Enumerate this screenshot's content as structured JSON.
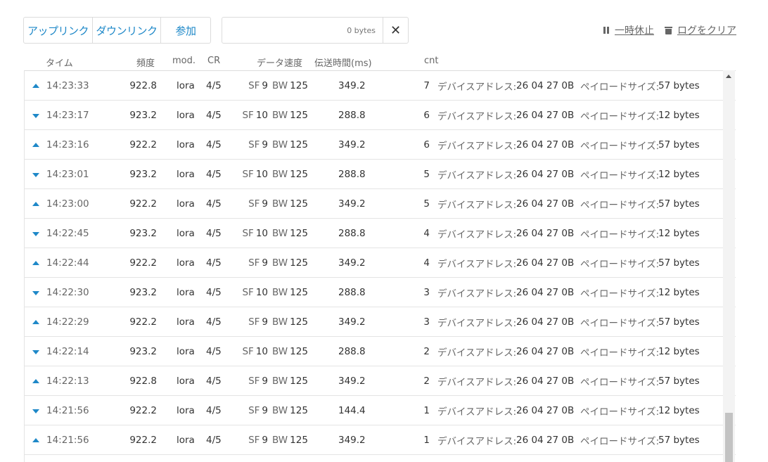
{
  "toolbar": {
    "filters": [
      "アップリンク",
      "ダウンリンク",
      "参加"
    ],
    "search_placeholder": "0 bytes",
    "clear_symbol": "✕",
    "pause_label": "一時休止",
    "clear_log_label": "ログをクリア"
  },
  "columns": {
    "time": "タイム",
    "freq": "頻度",
    "mod": "mod.",
    "cr": "CR",
    "datarate": "データ速度",
    "airtime": "伝送時間(ms)",
    "cnt": "cnt"
  },
  "labels": {
    "sf": "SF",
    "bw": "BW",
    "device_address": "デバイスアドレス:",
    "payload_size": "ペイロードサイズ:"
  },
  "rows": [
    {
      "dir": "up",
      "time": "14:23:33",
      "freq": "922.8",
      "mod": "lora",
      "cr": "4/5",
      "sf": "9",
      "bw": "125",
      "airtime": "349.2",
      "cnt": "7",
      "devaddr": "26 04 27 0B",
      "payload": "57 bytes"
    },
    {
      "dir": "down",
      "time": "14:23:17",
      "freq": "923.2",
      "mod": "lora",
      "cr": "4/5",
      "sf": "10",
      "bw": "125",
      "airtime": "288.8",
      "cnt": "6",
      "devaddr": "26 04 27 0B",
      "payload": "12 bytes"
    },
    {
      "dir": "up",
      "time": "14:23:16",
      "freq": "922.2",
      "mod": "lora",
      "cr": "4/5",
      "sf": "9",
      "bw": "125",
      "airtime": "349.2",
      "cnt": "6",
      "devaddr": "26 04 27 0B",
      "payload": "57 bytes"
    },
    {
      "dir": "down",
      "time": "14:23:01",
      "freq": "923.2",
      "mod": "lora",
      "cr": "4/5",
      "sf": "10",
      "bw": "125",
      "airtime": "288.8",
      "cnt": "5",
      "devaddr": "26 04 27 0B",
      "payload": "12 bytes"
    },
    {
      "dir": "up",
      "time": "14:23:00",
      "freq": "922.2",
      "mod": "lora",
      "cr": "4/5",
      "sf": "9",
      "bw": "125",
      "airtime": "349.2",
      "cnt": "5",
      "devaddr": "26 04 27 0B",
      "payload": "57 bytes"
    },
    {
      "dir": "down",
      "time": "14:22:45",
      "freq": "923.2",
      "mod": "lora",
      "cr": "4/5",
      "sf": "10",
      "bw": "125",
      "airtime": "288.8",
      "cnt": "4",
      "devaddr": "26 04 27 0B",
      "payload": "12 bytes"
    },
    {
      "dir": "up",
      "time": "14:22:44",
      "freq": "922.2",
      "mod": "lora",
      "cr": "4/5",
      "sf": "9",
      "bw": "125",
      "airtime": "349.2",
      "cnt": "4",
      "devaddr": "26 04 27 0B",
      "payload": "57 bytes"
    },
    {
      "dir": "down",
      "time": "14:22:30",
      "freq": "923.2",
      "mod": "lora",
      "cr": "4/5",
      "sf": "10",
      "bw": "125",
      "airtime": "288.8",
      "cnt": "3",
      "devaddr": "26 04 27 0B",
      "payload": "12 bytes"
    },
    {
      "dir": "up",
      "time": "14:22:29",
      "freq": "922.2",
      "mod": "lora",
      "cr": "4/5",
      "sf": "9",
      "bw": "125",
      "airtime": "349.2",
      "cnt": "3",
      "devaddr": "26 04 27 0B",
      "payload": "57 bytes"
    },
    {
      "dir": "down",
      "time": "14:22:14",
      "freq": "923.2",
      "mod": "lora",
      "cr": "4/5",
      "sf": "10",
      "bw": "125",
      "airtime": "288.8",
      "cnt": "2",
      "devaddr": "26 04 27 0B",
      "payload": "12 bytes"
    },
    {
      "dir": "up",
      "time": "14:22:13",
      "freq": "922.8",
      "mod": "lora",
      "cr": "4/5",
      "sf": "9",
      "bw": "125",
      "airtime": "349.2",
      "cnt": "2",
      "devaddr": "26 04 27 0B",
      "payload": "57 bytes"
    },
    {
      "dir": "down",
      "time": "14:21:56",
      "freq": "922.2",
      "mod": "lora",
      "cr": "4/5",
      "sf": "9",
      "bw": "125",
      "airtime": "144.4",
      "cnt": "1",
      "devaddr": "26 04 27 0B",
      "payload": "12 bytes"
    },
    {
      "dir": "up",
      "time": "14:21:56",
      "freq": "922.2",
      "mod": "lora",
      "cr": "4/5",
      "sf": "9",
      "bw": "125",
      "airtime": "349.2",
      "cnt": "1",
      "devaddr": "26 04 27 0B",
      "payload": "57 bytes"
    }
  ]
}
